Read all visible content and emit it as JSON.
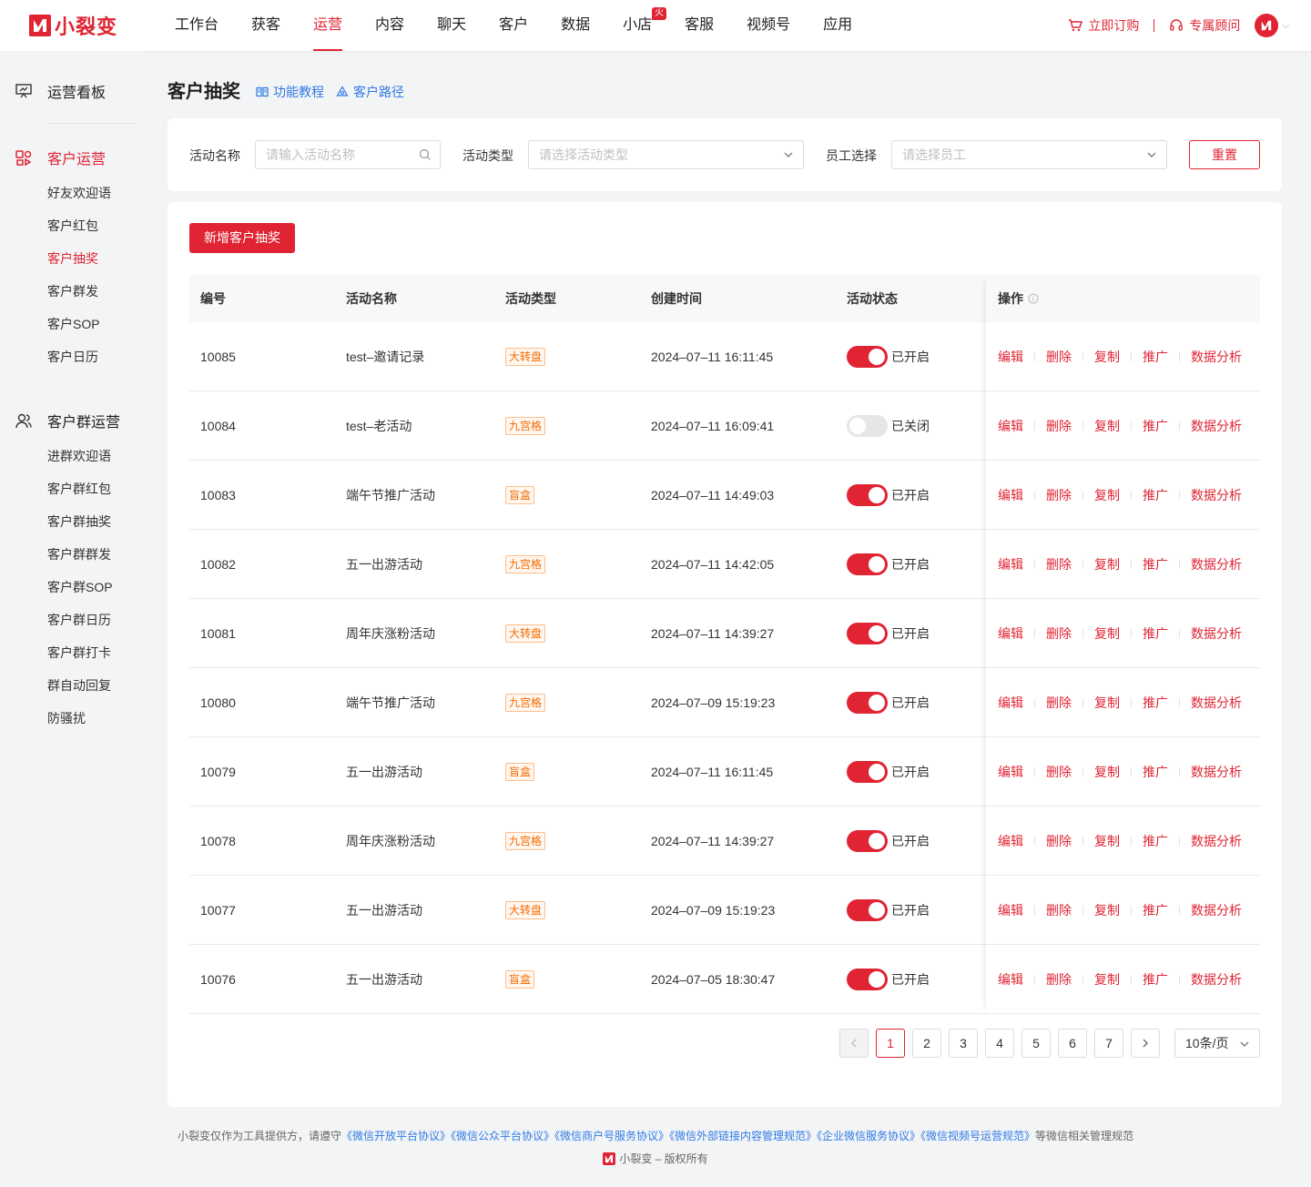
{
  "brand": {
    "name": "小裂变",
    "color": "#e02433"
  },
  "nav": {
    "items": [
      {
        "label": "工作台"
      },
      {
        "label": "获客"
      },
      {
        "label": "运营",
        "active": true
      },
      {
        "label": "内容"
      },
      {
        "label": "聊天"
      },
      {
        "label": "客户"
      },
      {
        "label": "数据"
      },
      {
        "label": "小店",
        "badge": "火爆"
      },
      {
        "label": "客服"
      },
      {
        "label": "视频号"
      },
      {
        "label": "应用"
      }
    ],
    "order_label": "立即订购",
    "advisor_label": "专属顾问"
  },
  "sidebar": {
    "top_label": "运营看板",
    "group1": {
      "label": "客户运营",
      "items": [
        "好友欢迎语",
        "客户红包",
        "客户抽奖",
        "客户群发",
        "客户SOP",
        "客户日历"
      ],
      "active_index": 2
    },
    "group2": {
      "label": "客户群运营",
      "items": [
        "进群欢迎语",
        "客户群红包",
        "客户群抽奖",
        "客户群群发",
        "客户群SOP",
        "客户群日历",
        "客户群打卡",
        "群自动回复",
        "防骚扰"
      ]
    }
  },
  "page": {
    "title": "客户抽奖",
    "tutorial_link": "功能教程",
    "path_link": "客户路径"
  },
  "filters": {
    "name_label": "活动名称",
    "name_placeholder": "请输入活动名称",
    "type_label": "活动类型",
    "type_placeholder": "请选择活动类型",
    "staff_label": "员工选择",
    "staff_placeholder": "请选择员工",
    "reset_label": "重置"
  },
  "add_button": "新增客户抽奖",
  "table": {
    "headers": [
      "编号",
      "活动名称",
      "活动类型",
      "创建时间",
      "活动状态",
      "操作"
    ],
    "actions": [
      "编辑",
      "删除",
      "复制",
      "推广",
      "数据分析"
    ],
    "rows": [
      {
        "id": "10085",
        "name": "test–邀请记录",
        "type": "大转盘",
        "created": "2024–07–11 16:11:45",
        "on": true,
        "status": "已开启"
      },
      {
        "id": "10084",
        "name": "test–老活动",
        "type": "九宫格",
        "created": "2024–07–11 16:09:41",
        "on": false,
        "status": "已关闭"
      },
      {
        "id": "10083",
        "name": "端午节推广活动",
        "type": "盲盒",
        "created": "2024–07–11 14:49:03",
        "on": true,
        "status": "已开启"
      },
      {
        "id": "10082",
        "name": "五一出游活动",
        "type": "九宫格",
        "created": "2024–07–11 14:42:05",
        "on": true,
        "status": "已开启"
      },
      {
        "id": "10081",
        "name": "周年庆涨粉活动",
        "type": "大转盘",
        "created": "2024–07–11 14:39:27",
        "on": true,
        "status": "已开启"
      },
      {
        "id": "10080",
        "name": "端午节推广活动",
        "type": "九宫格",
        "created": "2024–07–09 15:19:23",
        "on": true,
        "status": "已开启"
      },
      {
        "id": "10079",
        "name": "五一出游活动",
        "type": "盲盒",
        "created": "2024–07–11 16:11:45",
        "on": true,
        "status": "已开启"
      },
      {
        "id": "10078",
        "name": "周年庆涨粉活动",
        "type": "九宫格",
        "created": "2024–07–11 14:39:27",
        "on": true,
        "status": "已开启"
      },
      {
        "id": "10077",
        "name": "五一出游活动",
        "type": "大转盘",
        "created": "2024–07–09 15:19:23",
        "on": true,
        "status": "已开启"
      },
      {
        "id": "10076",
        "name": "五一出游活动",
        "type": "盲盒",
        "created": "2024–07–05 18:30:47",
        "on": true,
        "status": "已开启"
      }
    ]
  },
  "pagination": {
    "pages": [
      "1",
      "2",
      "3",
      "4",
      "5",
      "6",
      "7"
    ],
    "current": "1",
    "page_size": "10条/页"
  },
  "footer": {
    "prefix": "小裂变仅作为工具提供方，请遵守",
    "agreements": [
      "《微信开放平台协议》",
      "《微信公众平台协议》",
      "《微信商户号服务协议》",
      "《微信外部链接内容管理规范》",
      "《企业微信服务协议》",
      "《微信视频号运营规范》"
    ],
    "suffix": "等微信相关管理规范",
    "copyright": "小裂变 – 版权所有"
  }
}
